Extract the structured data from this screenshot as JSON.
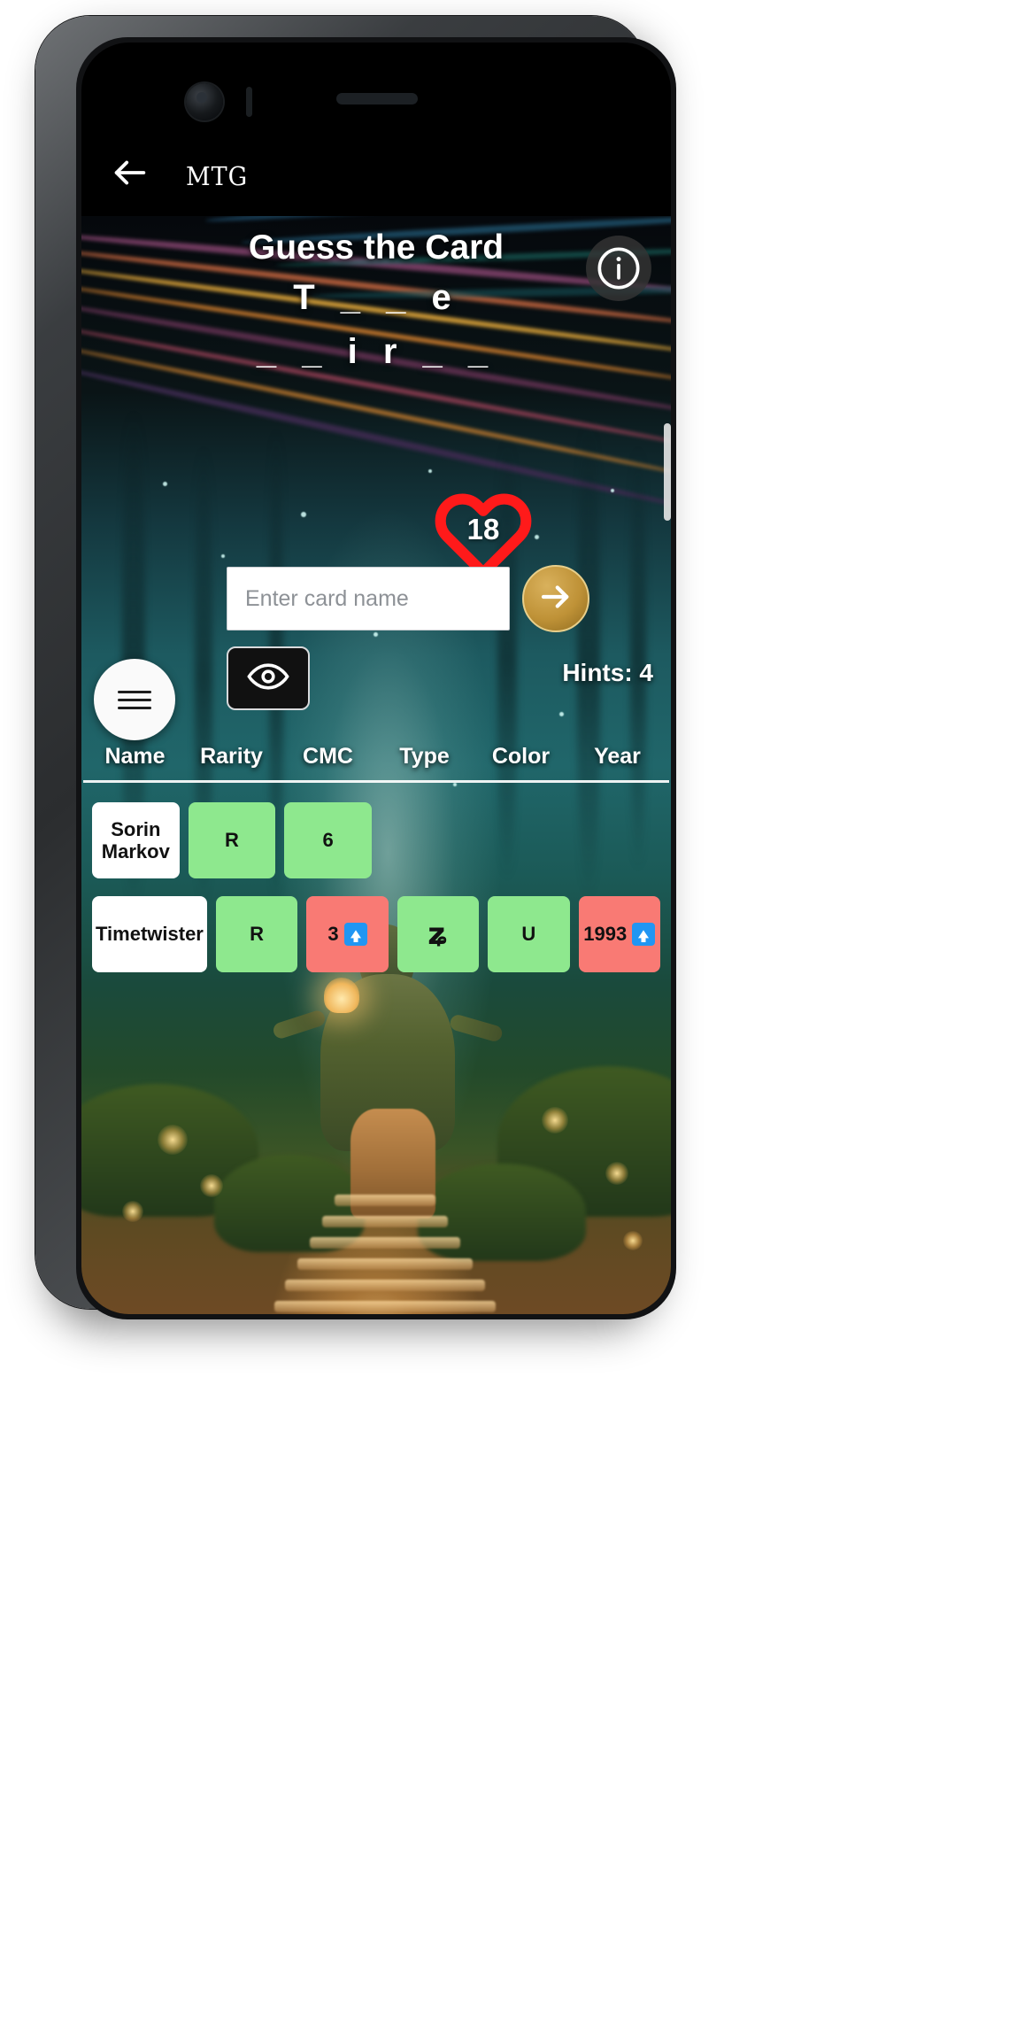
{
  "app": {
    "brand": "mtg",
    "back_icon": "back-arrow-icon"
  },
  "header": {
    "title": "Guess the Card",
    "info_icon": "info-icon"
  },
  "puzzle": {
    "line1": "T _ _ e",
    "line2": "_ _ i r _ _"
  },
  "lives": {
    "icon": "heart-icon",
    "count": "18",
    "color": "#ff1a1a"
  },
  "guess": {
    "placeholder": "Enter card name",
    "value": "",
    "submit_icon": "arrow-right-icon"
  },
  "hints": {
    "reveal_icon": "eye-icon",
    "label": "Hints: 4"
  },
  "menu": {
    "icon": "hamburger-menu-icon"
  },
  "table": {
    "columns": [
      "Name",
      "Rarity",
      "CMC",
      "Type",
      "Color",
      "Year"
    ],
    "rows": [
      {
        "cells": [
          {
            "text": "Sorin Markov",
            "state": "name"
          },
          {
            "text": "R",
            "state": "green"
          },
          {
            "text": "6",
            "state": "green"
          },
          {
            "text": "",
            "state": "empty"
          },
          {
            "text": "",
            "state": "empty"
          },
          {
            "text": "",
            "state": "empty"
          }
        ]
      },
      {
        "cells": [
          {
            "text": "Timetwister",
            "state": "name"
          },
          {
            "text": "R",
            "state": "green"
          },
          {
            "text": "3",
            "state": "red",
            "hint": "up"
          },
          {
            "text": "ʑ",
            "state": "green",
            "glyph": true
          },
          {
            "text": "U",
            "state": "green"
          },
          {
            "text": "1993",
            "state": "red",
            "hint": "up"
          }
        ]
      }
    ]
  },
  "colors": {
    "correct": "#8ee88e",
    "wrong_high": "#f97a74",
    "neutral": "#ffffff",
    "accent_gold": "#bf9237"
  }
}
